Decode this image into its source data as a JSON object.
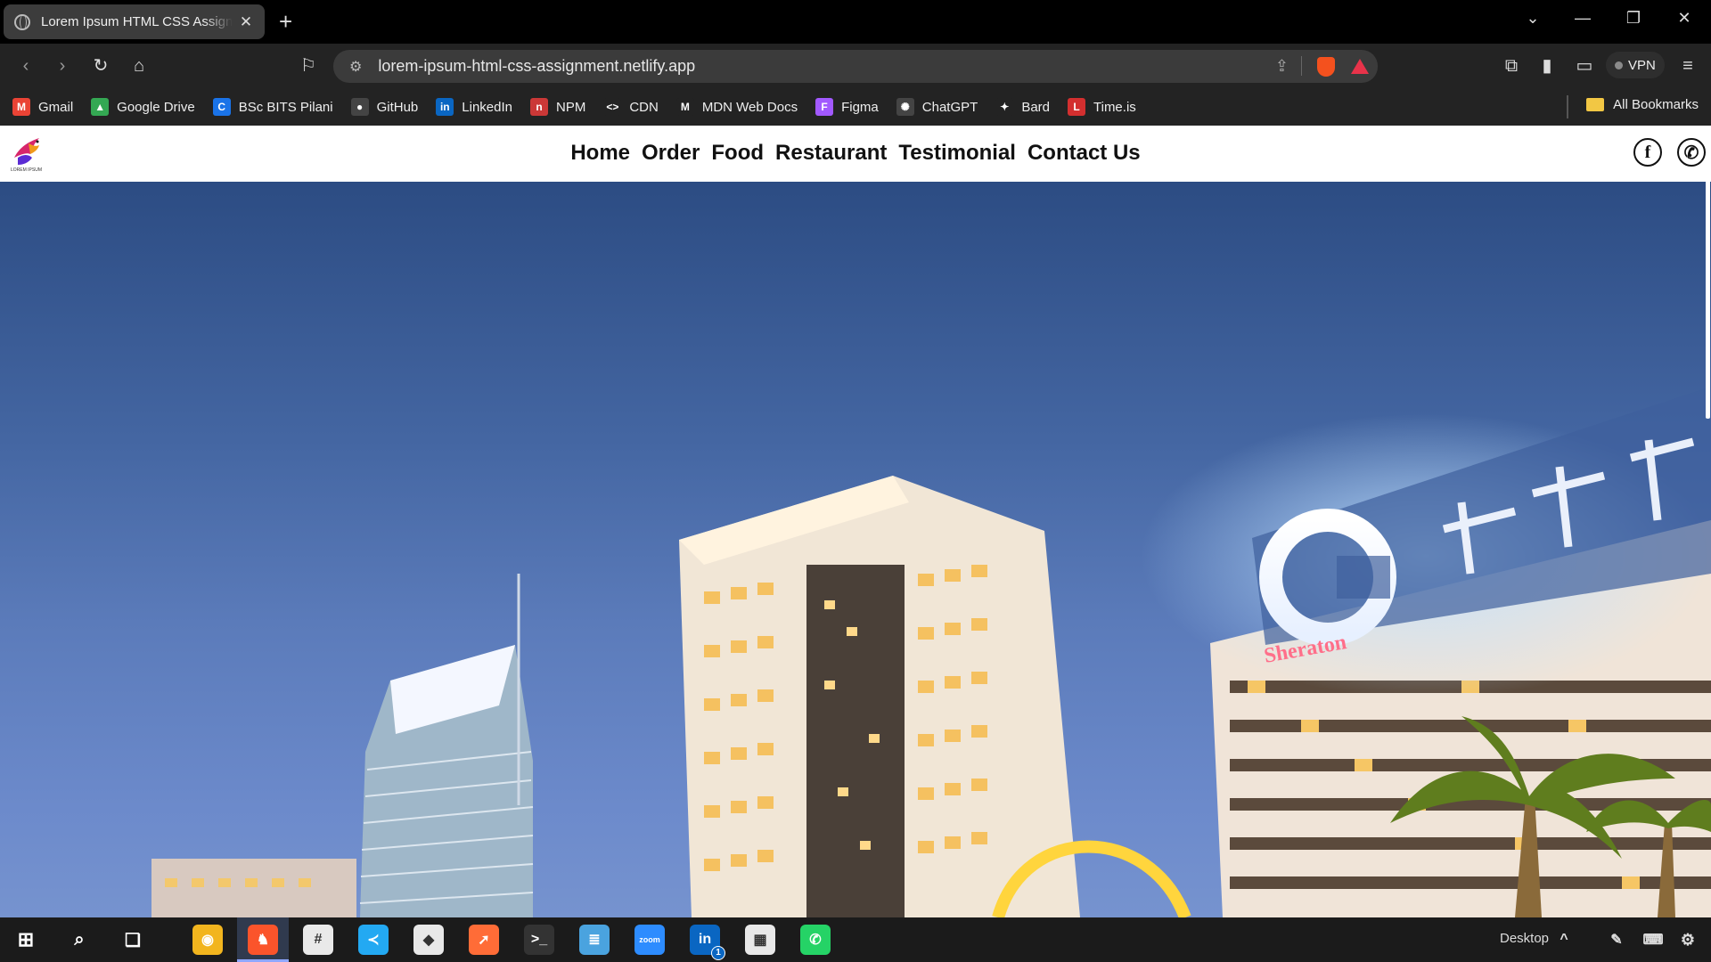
{
  "browser": {
    "tab_title": "Lorem Ipsum HTML CSS Assignment",
    "url": "lorem-ipsum-html-css-assignment.netlify.app",
    "vpn_label": "VPN",
    "bookmarks": [
      {
        "label": "Gmail",
        "icon": "gmail-icon",
        "color": "#ea4335",
        "glyph": "M"
      },
      {
        "label": "Google Drive",
        "icon": "google-drive-icon",
        "color": "#34a853",
        "glyph": "▲"
      },
      {
        "label": "BSc BITS Pilani",
        "icon": "bits-icon",
        "color": "#1a73e8",
        "glyph": "C"
      },
      {
        "label": "GitHub",
        "icon": "github-icon",
        "color": "#444444",
        "glyph": "●"
      },
      {
        "label": "LinkedIn",
        "icon": "linkedin-icon",
        "color": "#0a66c2",
        "glyph": "in"
      },
      {
        "label": "NPM",
        "icon": "npm-icon",
        "color": "#cb3837",
        "glyph": "n"
      },
      {
        "label": "CDN",
        "icon": "code-icon",
        "color": "#232323",
        "glyph": "<>"
      },
      {
        "label": "MDN Web Docs",
        "icon": "mdn-icon",
        "color": "#232323",
        "glyph": "M"
      },
      {
        "label": "Figma",
        "icon": "figma-icon",
        "color": "#a259ff",
        "glyph": "F"
      },
      {
        "label": "ChatGPT",
        "icon": "chatgpt-icon",
        "color": "#444444",
        "glyph": "✺"
      },
      {
        "label": "Bard",
        "icon": "bard-icon",
        "color": "#232323",
        "glyph": "✦"
      },
      {
        "label": "Time.is",
        "icon": "timeis-icon",
        "color": "#d32f2f",
        "glyph": "L"
      }
    ],
    "all_bookmarks_label": "All Bookmarks"
  },
  "site": {
    "logo_text": "LOREM IPSUM",
    "nav": [
      "Home",
      "Order",
      "Food",
      "Restaurant",
      "Testimonial",
      "Contact Us"
    ],
    "social": [
      {
        "name": "facebook-icon",
        "glyph": "f"
      },
      {
        "name": "whatsapp-icon",
        "glyph": "✆"
      }
    ]
  },
  "hero": {
    "sign_text": "Sheraton"
  },
  "taskbar": {
    "apps": [
      {
        "name": "chrome-icon",
        "color": "#f2b51e",
        "glyph": "◉"
      },
      {
        "name": "brave-icon",
        "color": "#fb542b",
        "glyph": "♞"
      },
      {
        "name": "slack-icon",
        "color": "#e9e9e9",
        "glyph": "#"
      },
      {
        "name": "vscode-icon",
        "color": "#23a9f2",
        "glyph": "≺"
      },
      {
        "name": "mongodb-compass-icon",
        "color": "#e8e8e8",
        "glyph": "◆"
      },
      {
        "name": "postman-icon",
        "color": "#ff6c37",
        "glyph": "➚"
      },
      {
        "name": "terminal-icon",
        "color": "#333333",
        "glyph": ">_"
      },
      {
        "name": "notepad-icon",
        "color": "#4aa3df",
        "glyph": "≣"
      },
      {
        "name": "zoom-icon",
        "color": "#2d8cff",
        "glyph": "zoom"
      },
      {
        "name": "linkedin-app-icon",
        "color": "#0a66c2",
        "glyph": "in"
      },
      {
        "name": "microsoft-store-icon",
        "color": "#e8e8e8",
        "glyph": "▦"
      },
      {
        "name": "whatsapp-app-icon",
        "color": "#25d366",
        "glyph": "✆"
      }
    ],
    "linkedin_badge": "1",
    "desktop_label": "Desktop"
  }
}
